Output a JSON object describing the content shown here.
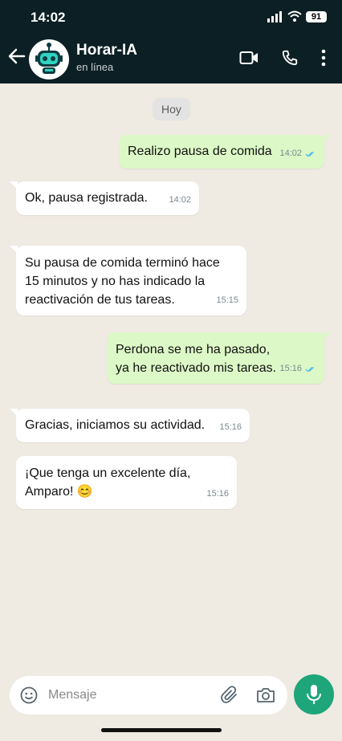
{
  "status_bar": {
    "time": "14:02",
    "battery": "91"
  },
  "header": {
    "name": "Horar-IA",
    "status": "en línea"
  },
  "chat": {
    "day_label": "Hoy",
    "messages": [
      {
        "dir": "out",
        "text": "Realizo pausa de comida",
        "time": "14:02",
        "read": true
      },
      {
        "dir": "in",
        "text": "Ok, pausa registrada.",
        "time": "14:02"
      },
      {
        "dir": "in",
        "text": "Su pausa de comida terminó hace 15 minutos y no has indicado la reactivación de tus tareas.",
        "time": "15:15"
      },
      {
        "dir": "out",
        "text": "Perdona se me ha pasado, ya he reactivado mis tareas.",
        "time": "15:16",
        "read": true
      },
      {
        "dir": "in",
        "text": "Gracias, iniciamos su actividad.",
        "time": "15:16"
      },
      {
        "dir": "in",
        "text": "¡Que tenga un excelente día, Amparo! 😊",
        "time": "15:16"
      }
    ]
  },
  "composer": {
    "placeholder": "Mensaje"
  },
  "icons": {
    "back": "arrow-left-icon",
    "video": "video-call-icon",
    "phone": "phone-call-icon",
    "menu": "more-vertical-icon",
    "emoji": "emoji-icon",
    "attach": "paperclip-icon",
    "camera": "camera-icon",
    "mic": "microphone-icon"
  },
  "colors": {
    "header": "#0b1f24",
    "outgoing": "#dcf8c6",
    "incoming": "#ffffff",
    "accent": "#1ea67a",
    "read_ticks": "#53bdeb"
  }
}
